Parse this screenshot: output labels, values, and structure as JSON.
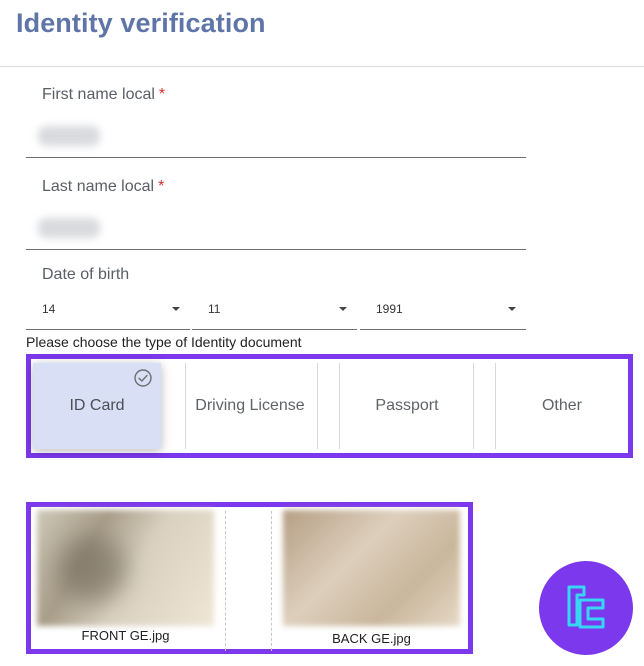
{
  "page": {
    "title": "Identity verification"
  },
  "form": {
    "first_name": {
      "label": "First name local",
      "required_mark": "*",
      "value": ""
    },
    "last_name": {
      "label": "Last name local",
      "required_mark": "*",
      "value": ""
    },
    "date_of_birth": {
      "label": "Date of birth",
      "day": "14",
      "month": "11",
      "year": "1991"
    }
  },
  "document_type": {
    "prompt": "Please choose the type of Identity document",
    "options": [
      {
        "label": "ID Card",
        "selected": true
      },
      {
        "label": "Driving License",
        "selected": false
      },
      {
        "label": "Passport",
        "selected": false
      },
      {
        "label": "Other",
        "selected": false
      }
    ]
  },
  "uploads": {
    "files": [
      {
        "name": "FRONT GE.jpg"
      },
      {
        "name": "BACK GE.jpg"
      }
    ]
  },
  "colors": {
    "title": "#5f75a7",
    "highlight_border": "#7b38ec",
    "selected_bg": "#d9e0f5",
    "required": "#d32f2f",
    "logo_bg": "#7b38ec",
    "logo_mark": "#38d6f5"
  },
  "icons": {
    "selected_check": "check-circle-icon",
    "select_caret": "caret-down-icon",
    "brand": "tc-logo"
  }
}
